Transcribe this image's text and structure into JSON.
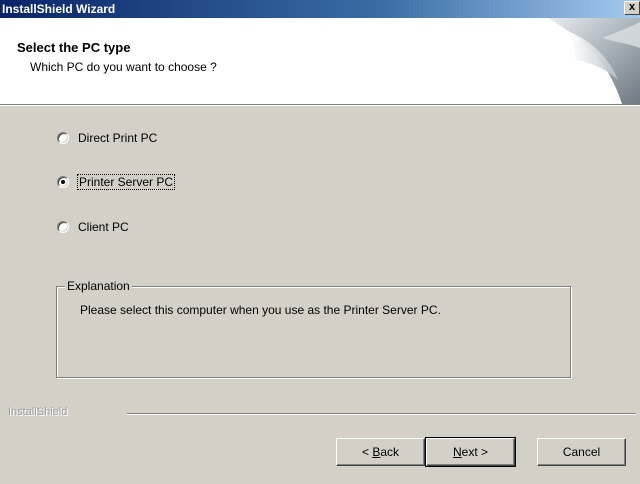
{
  "window": {
    "title": "InstallShield Wizard",
    "close_glyph": "x"
  },
  "header": {
    "heading": "Select the PC type",
    "subheading": "Which PC do you want to choose ?"
  },
  "options": [
    {
      "label": "Direct Print PC",
      "checked": false
    },
    {
      "label": "Printer Server PC",
      "checked": true
    },
    {
      "label": "Client PC",
      "checked": false
    }
  ],
  "explanation": {
    "legend": "Explanation",
    "text": "Please select this computer when you use as the Printer Server PC."
  },
  "footer": {
    "brand": "InstallShield"
  },
  "buttons": {
    "back": {
      "pre": "< ",
      "accel": "B",
      "post": "ack"
    },
    "next": {
      "pre": "",
      "accel": "N",
      "post": "ext >"
    },
    "cancel": "Cancel"
  },
  "colors": {
    "titlebar_start": "#0a246a",
    "face": "#d4d0c8",
    "header_bg": "#ffffff"
  }
}
